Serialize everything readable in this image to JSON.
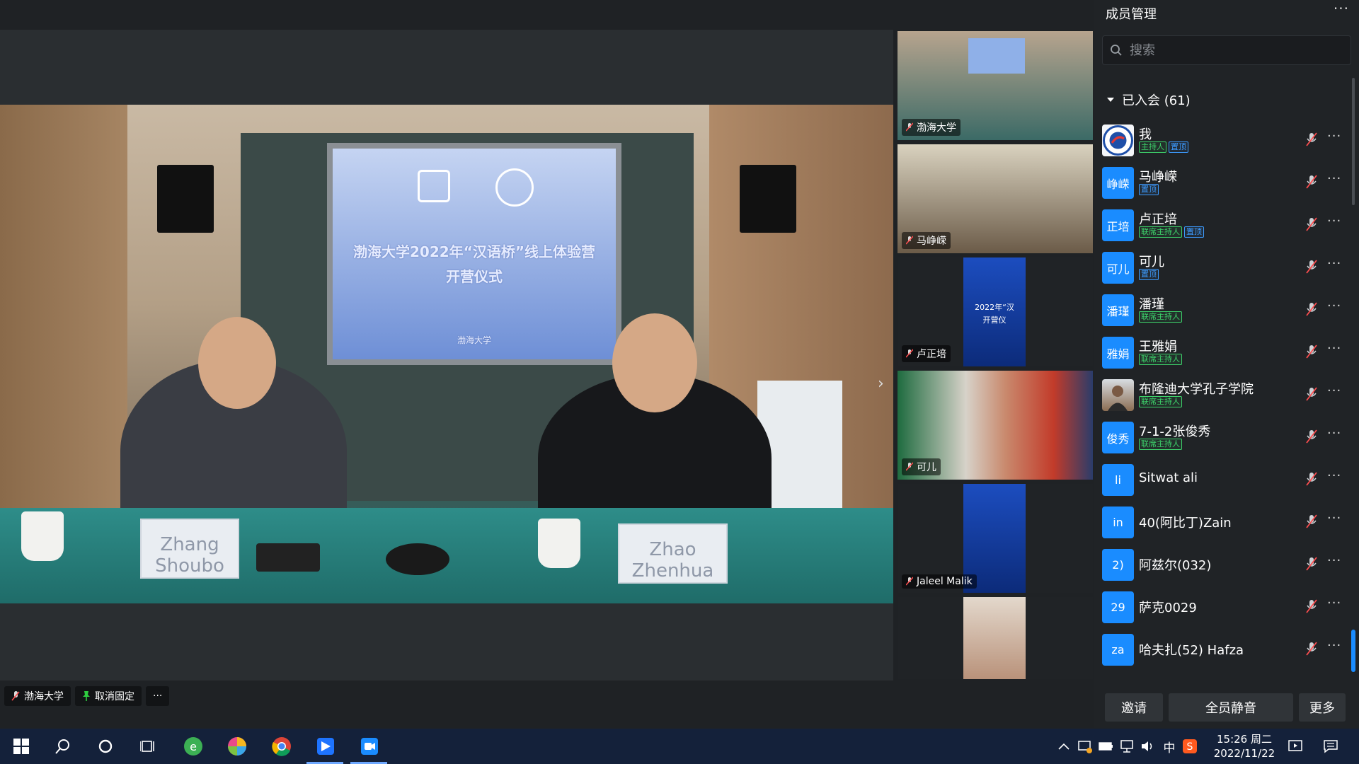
{
  "main_stage": {
    "screen_text_line1": "渤海大学2022年“汉语桥”线上体验营",
    "screen_text_line2": "开营仪式",
    "screen_footer": "渤海大学",
    "nameplate_left": "Zhang Shoubo",
    "nameplate_right": "Zhao Zhenhua",
    "controls": {
      "speaker_label": "渤海大学",
      "unpin_label": "取消固定",
      "more_label": "···"
    },
    "next_arrow": "›"
  },
  "thumbnails": [
    {
      "label": "渤海大学"
    },
    {
      "label": "马峥嵘"
    },
    {
      "label": "卢正培",
      "poster_line1": "2022年“汉",
      "poster_line2": "开营仪"
    },
    {
      "label": "可儿"
    },
    {
      "label": "Jaleel Malik"
    },
    {
      "label": ""
    }
  ],
  "panel": {
    "title": "成员管理",
    "more": "···",
    "search_placeholder": "搜索",
    "group_title": "已入会 (61)",
    "members": [
      {
        "name": "我",
        "avatar": "",
        "tags": [
          {
            "text": "主持人",
            "color": "green"
          },
          {
            "text": "置顶",
            "color": "blue"
          }
        ]
      },
      {
        "name": "马峥嵘",
        "avatar": "峥嵘",
        "tags": [
          {
            "text": "置顶",
            "color": "blue"
          }
        ]
      },
      {
        "name": "卢正培",
        "avatar": "正培",
        "tags": [
          {
            "text": "联席主持人",
            "color": "green"
          },
          {
            "text": "置顶",
            "color": "blue"
          }
        ]
      },
      {
        "name": "可儿",
        "avatar": "可儿",
        "tags": [
          {
            "text": "置顶",
            "color": "blue"
          }
        ]
      },
      {
        "name": "潘瑾",
        "avatar": "潘瑾",
        "tags": [
          {
            "text": "联席主持人",
            "color": "green"
          }
        ]
      },
      {
        "name": "王雅娟",
        "avatar": "雅娟",
        "tags": [
          {
            "text": "联席主持人",
            "color": "green"
          }
        ]
      },
      {
        "name": "布隆迪大学孔子学院",
        "avatar": "",
        "tags": [
          {
            "text": "联席主持人",
            "color": "green"
          }
        ]
      },
      {
        "name": "7-1-2张俊秀",
        "avatar": "俊秀",
        "tags": [
          {
            "text": "联席主持人",
            "color": "green"
          }
        ]
      },
      {
        "name": "Sitwat ali",
        "avatar": "li",
        "tags": []
      },
      {
        "name": "40(阿比丁)Zain",
        "avatar": "in",
        "tags": []
      },
      {
        "name": "阿兹尔(032)",
        "avatar": "2)",
        "tags": []
      },
      {
        "name": "萨克0029",
        "avatar": "29",
        "tags": []
      },
      {
        "name": "哈夫扎(52) Hafza",
        "avatar": "za",
        "tags": []
      }
    ],
    "footer": {
      "invite": "邀请",
      "mute_all": "全员静音",
      "more": "更多"
    }
  },
  "taskbar": {
    "ime": "中",
    "time": "15:26 周二",
    "date": "2022/11/22"
  },
  "colors": {
    "accent": "#1a8cff",
    "host_tag": "#3dd16a",
    "pin_tag": "#3d9bff",
    "panel_bg": "#202326",
    "taskbar_bg": "#14213a"
  }
}
